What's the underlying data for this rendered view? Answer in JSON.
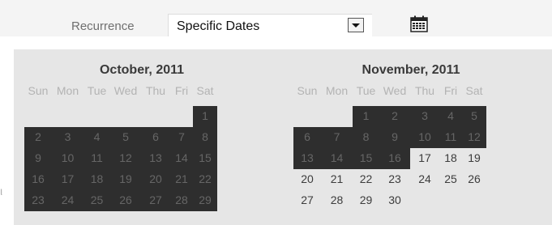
{
  "topbar": {
    "recurrence_label": "Recurrence",
    "recurrence_value": "Specific Dates",
    "dropdown_icon": "chevron-down-icon",
    "calendar_icon": "calendar-icon"
  },
  "side_glyph": "ι",
  "calendar": {
    "weekday_labels": [
      "Sun",
      "Mon",
      "Tue",
      "Wed",
      "Thu",
      "Fri",
      "Sat"
    ],
    "months": [
      {
        "title": "October, 2011",
        "weeks": [
          [
            "",
            "",
            "",
            "",
            "",
            "",
            "1"
          ],
          [
            "2",
            "3",
            "4",
            "5",
            "6",
            "7",
            "8"
          ],
          [
            "9",
            "10",
            "11",
            "12",
            "13",
            "14",
            "15"
          ],
          [
            "16",
            "17",
            "18",
            "19",
            "20",
            "21",
            "22"
          ],
          [
            "23",
            "24",
            "25",
            "26",
            "27",
            "28",
            "29"
          ]
        ],
        "selected": [
          [
            false,
            false,
            false,
            false,
            false,
            false,
            true
          ],
          [
            true,
            true,
            true,
            true,
            true,
            true,
            true
          ],
          [
            true,
            true,
            true,
            true,
            true,
            true,
            true
          ],
          [
            true,
            true,
            true,
            true,
            true,
            true,
            true
          ],
          [
            true,
            true,
            true,
            true,
            true,
            true,
            true
          ]
        ]
      },
      {
        "title": "November, 2011",
        "weeks": [
          [
            "",
            "",
            "1",
            "2",
            "3",
            "4",
            "5"
          ],
          [
            "6",
            "7",
            "8",
            "9",
            "10",
            "11",
            "12"
          ],
          [
            "13",
            "14",
            "15",
            "16",
            "17",
            "18",
            "19"
          ],
          [
            "20",
            "21",
            "22",
            "23",
            "24",
            "25",
            "26"
          ],
          [
            "27",
            "28",
            "29",
            "30",
            "",
            "",
            ""
          ]
        ],
        "selected": [
          [
            false,
            false,
            true,
            true,
            true,
            true,
            true
          ],
          [
            true,
            true,
            true,
            true,
            true,
            true,
            true
          ],
          [
            true,
            true,
            true,
            true,
            false,
            false,
            false
          ],
          [
            false,
            false,
            false,
            false,
            false,
            false,
            false
          ],
          [
            false,
            false,
            false,
            false,
            false,
            false,
            false
          ]
        ]
      }
    ]
  },
  "colors": {
    "selected_bg": "#2e2e2e",
    "popup_bg": "#e6e6e6",
    "topbar_bg": "#f4f4f4"
  }
}
